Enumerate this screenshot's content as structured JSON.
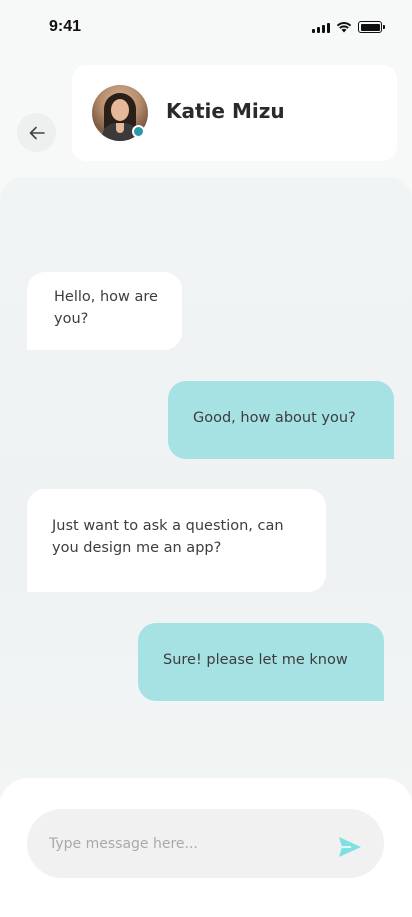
{
  "status_bar": {
    "time": "9:41"
  },
  "header": {
    "contact_name": "Katie Mizu",
    "online": true,
    "online_color": "#2b9aa8"
  },
  "icons": {
    "back": "arrow-left-icon",
    "send": "send-icon",
    "signal": "signal-icon",
    "wifi": "wifi-icon",
    "battery": "battery-icon"
  },
  "messages": [
    {
      "direction": "incoming",
      "text": "Hello, how are you?"
    },
    {
      "direction": "outgoing",
      "text": "Good, how about you?"
    },
    {
      "direction": "incoming",
      "text": "Just want to ask a question, can you design me an app?"
    },
    {
      "direction": "outgoing",
      "text": "Sure! please let me know"
    }
  ],
  "composer": {
    "placeholder": "Type message here...",
    "value": ""
  },
  "colors": {
    "outgoing_bubble": "#a6e1e3",
    "incoming_bubble": "#ffffff",
    "send_icon": "#7fe0e2"
  }
}
